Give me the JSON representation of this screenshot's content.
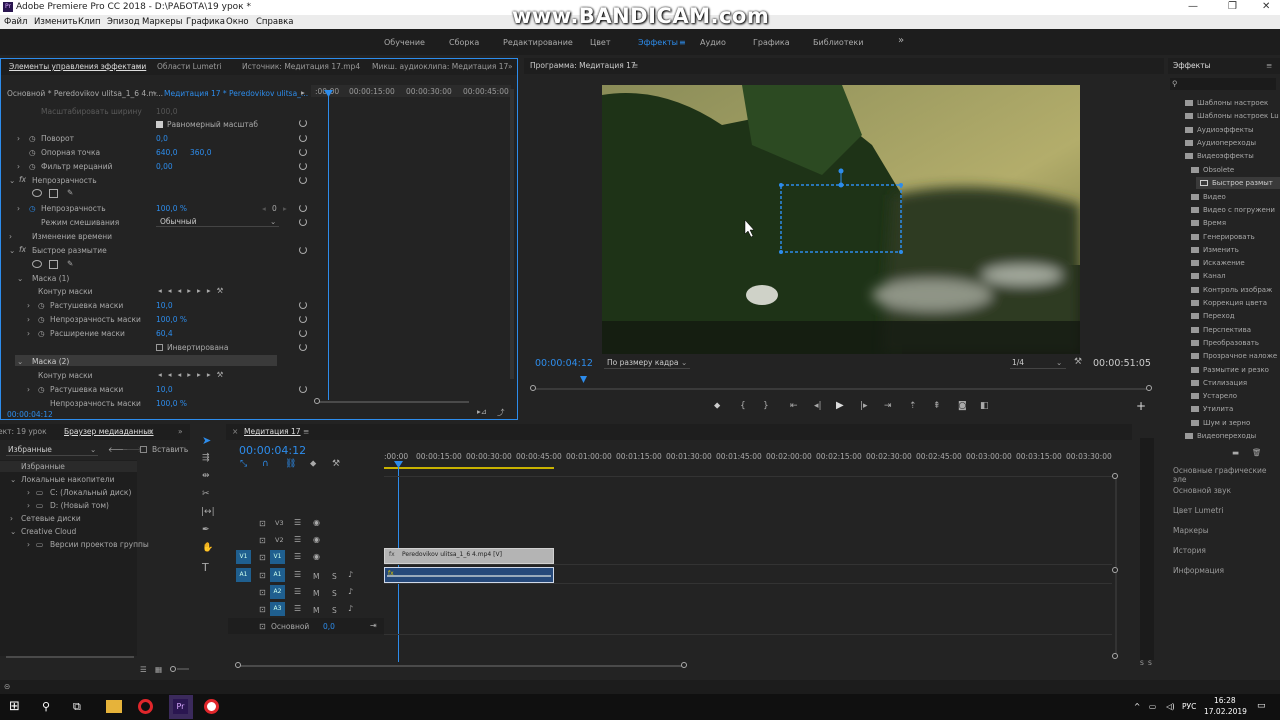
{
  "window": {
    "title": "Adobe Premiere Pro CC 2018 - D:\\РАБОТА\\19 урок *"
  },
  "menu": [
    "Файл",
    "Изменить",
    "Клип",
    "Эпизод",
    "Маркеры",
    "Графика",
    "Окно",
    "Справка"
  ],
  "watermark": "www.BANDICAM.com",
  "workspaces": [
    "Обучение",
    "Сборка",
    "Редактирование",
    "Цвет",
    "Эффекты",
    "Аудио",
    "Графика",
    "Библиотеки"
  ],
  "effect_controls": {
    "tabs": [
      "Элементы управления эффектами",
      "Области Lumetri",
      "Источник: Медитация 17.mp4",
      "Микш. аудиоклипа: Медитация 17"
    ],
    "master": "Основной * Peredovikov ulitsa_1_6 4.m...",
    "clip": "Медитация 17 * Peredovikov ulitsa_...",
    "ruler": [
      ":00:00",
      "00:00:15:00",
      "00:00:30:00",
      "00:00:45:00"
    ],
    "rows": {
      "scale_width": "Масштабировать ширину",
      "scale_width_val": "100,0",
      "uniform": "Равномерный масштаб",
      "rotation": "Поворот",
      "rotation_val": "0,0",
      "anchor": "Опорная точка",
      "anchor_x": "640,0",
      "anchor_y": "360,0",
      "flicker": "Фильтр мерцаний",
      "flicker_val": "0,00",
      "opacity_group": "Непрозрачность",
      "opacity": "Непрозрачность",
      "opacity_val": "100,0 %",
      "opacity_kf": "0",
      "blend": "Режим смешивания",
      "blend_val": "Обычный",
      "time_remap": "Изменение времени",
      "fast_blur": "Быстрое размытие",
      "mask1": "Маска (1)",
      "mask_path": "Контур маски",
      "feather": "Растушевка маски",
      "feather_val": "10,0",
      "mask_opacity": "Непрозрачность маски",
      "mask_opacity_val": "100,0 %",
      "expansion": "Расширение маски",
      "expansion_val": "60,4",
      "inverted": "Инвертирована",
      "mask2": "Маска (2)",
      "mask_path2": "Контур маски",
      "feather2": "Растушевка маски",
      "feather2_val": "10,0",
      "mask_opacity2": "Непрозрачность маски",
      "mask_opacity2_val": "100,0 %"
    },
    "timecode": "00:00:04:12"
  },
  "program": {
    "tab": "Программа: Медитация 17",
    "timecode": "00:00:04:12",
    "fit": "По размеру кадра",
    "quality": "1/4",
    "duration": "00:00:51:05"
  },
  "project": {
    "tabs": [
      "ект: 19 урок",
      "Браузер медиаданных"
    ],
    "dropdown": "Избранные",
    "insert": "Вставить",
    "tree": [
      "Избранные",
      "Локальные накопители",
      "C: (Локальный диск)",
      "D: (Новый том)",
      "Сетевые диски",
      "Creative Cloud",
      "Версии проектов группы"
    ]
  },
  "timeline": {
    "tab": "Медитация 17",
    "timecode": "00:00:04:12",
    "ruler": [
      ":00:00",
      "00:00:15:00",
      "00:00:30:00",
      "00:00:45:00",
      "00:01:00:00",
      "00:01:15:00",
      "00:01:30:00",
      "00:01:45:00",
      "00:02:00:00",
      "00:02:15:00",
      "00:02:30:00",
      "00:02:45:00",
      "00:03:00:00",
      "00:03:15:00",
      "00:03:30:00"
    ],
    "tracks": {
      "v3": "V3",
      "v2": "V2",
      "v1": "V1",
      "v1src": "V1",
      "a1": "A1",
      "a1src": "A1",
      "a2": "A2",
      "a3": "A3",
      "m": "M",
      "s": "S"
    },
    "master": "Основной",
    "master_val": "0,0",
    "clip": "Peredovikov ulitsa_1_6 4.mp4 [V]"
  },
  "effects": {
    "title": "Эффекты",
    "items": [
      "Шаблоны настроек",
      "Шаблоны настроек Lu",
      "Аудиоэффекты",
      "Аудиопереходы",
      "Видеоэффекты",
      "Obsolete",
      "Быстрое размыт",
      "Видео",
      "Видео с погружени",
      "Время",
      "Генерировать",
      "Изменить",
      "Искажение",
      "Канал",
      "Контроль изображ",
      "Коррекция цвета",
      "Переход",
      "Перспектива",
      "Преобразовать",
      "Прозрачное наложе",
      "Размытие и резко",
      "Стилизация",
      "Устарело",
      "Утилита",
      "Шум и зерно",
      "Видеопереходы"
    ],
    "panels": [
      "Основные графические эле",
      "Основной звук",
      "Цвет Lumetri",
      "Маркеры",
      "История",
      "Информация"
    ]
  },
  "taskbar": {
    "lang": "РУС",
    "time": "16:28",
    "date": "17.02.2019"
  }
}
